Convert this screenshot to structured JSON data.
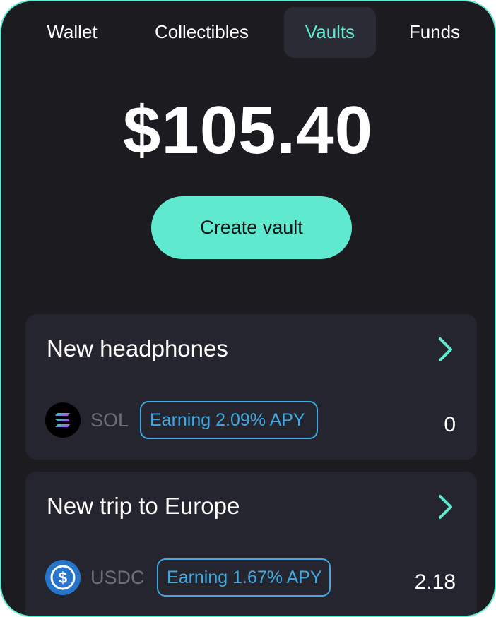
{
  "tabs": [
    {
      "label": "Wallet"
    },
    {
      "label": "Collectibles"
    },
    {
      "label": "Vaults"
    },
    {
      "label": "Funds"
    }
  ],
  "active_tab": "Vaults",
  "balance": "$105.40",
  "create_vault_label": "Create vault",
  "vaults": [
    {
      "title": "New headphones",
      "token": "SOL",
      "token_icon": "solana-icon",
      "apy_label": "Earning 2.09% APY",
      "amount": "0"
    },
    {
      "title": "New trip to Europe",
      "token": "USDC",
      "token_icon": "usdc-icon",
      "apy_label": "Earning 1.67% APY",
      "amount": "2.18"
    }
  ],
  "colors": {
    "accent": "#5fe9cf",
    "background": "#1c1c20",
    "card": "#25252f",
    "badge": "#3fa9e0"
  }
}
